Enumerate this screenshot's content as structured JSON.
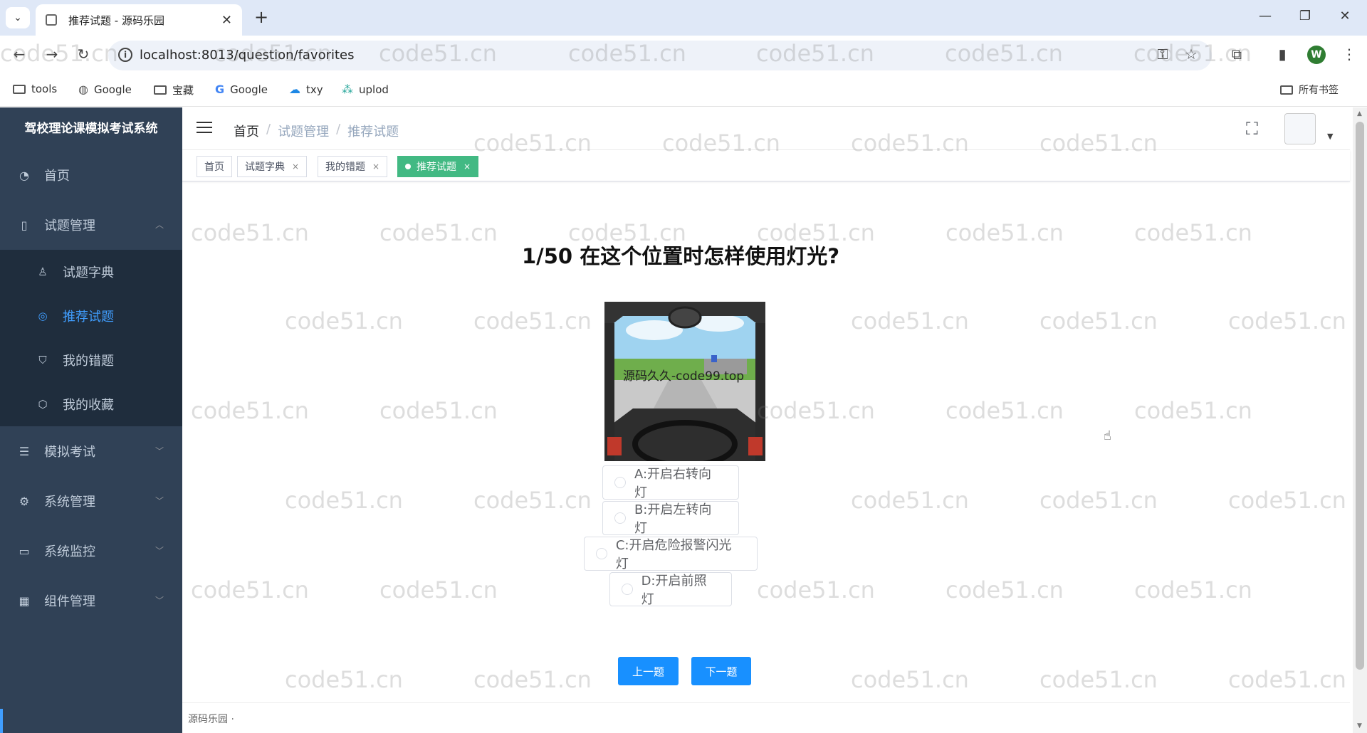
{
  "browser": {
    "tab_title": "推荐试题 - 源码乐园",
    "url": "localhost:8013/question/favorites",
    "profile_initial": "W",
    "bookmarks": [
      "tools",
      "Google",
      "宝藏",
      "Google",
      "txy",
      "uplod"
    ],
    "all_bookmarks_label": "所有书签"
  },
  "sidebar": {
    "app_title": "驾校理论课模拟考试系统",
    "items": [
      {
        "label": "首页",
        "icon": "dashboard-icon"
      },
      {
        "label": "试题管理",
        "icon": "book-icon",
        "expanded": true,
        "children": [
          {
            "label": "试题字典",
            "icon": "user-icon"
          },
          {
            "label": "推荐试题",
            "icon": "target-icon",
            "active": true
          },
          {
            "label": "我的错题",
            "icon": "shield-icon"
          },
          {
            "label": "我的收藏",
            "icon": "cube-icon"
          }
        ]
      },
      {
        "label": "模拟考试",
        "icon": "list-icon"
      },
      {
        "label": "系统管理",
        "icon": "gear-icon"
      },
      {
        "label": "系统监控",
        "icon": "monitor-icon"
      },
      {
        "label": "组件管理",
        "icon": "grid-icon"
      }
    ]
  },
  "breadcrumb": [
    "首页",
    "试题管理",
    "推荐试题"
  ],
  "tags": [
    {
      "label": "首页",
      "closable": false
    },
    {
      "label": "试题字典",
      "closable": true
    },
    {
      "label": "我的错题",
      "closable": true
    },
    {
      "label": "推荐试题",
      "closable": true,
      "active": true
    }
  ],
  "question": {
    "title": "1/50 在这个位置时怎样使用灯光?",
    "image_caption": "源码久久-code99.top",
    "options": [
      "A:开启右转向灯",
      "B:开启左转向灯",
      "C:开启危险报警闪光灯",
      "D:开启前照灯"
    ]
  },
  "buttons": {
    "prev": "上一题",
    "next": "下一题"
  },
  "footer": "源码乐园 ·",
  "watermark": "code51.cn",
  "colors": {
    "sidebar_bg": "#304156",
    "submenu_bg": "#1f2d3d",
    "active_menu": "#409eff",
    "active_tag": "#42b983",
    "primary_button": "#1890ff"
  }
}
